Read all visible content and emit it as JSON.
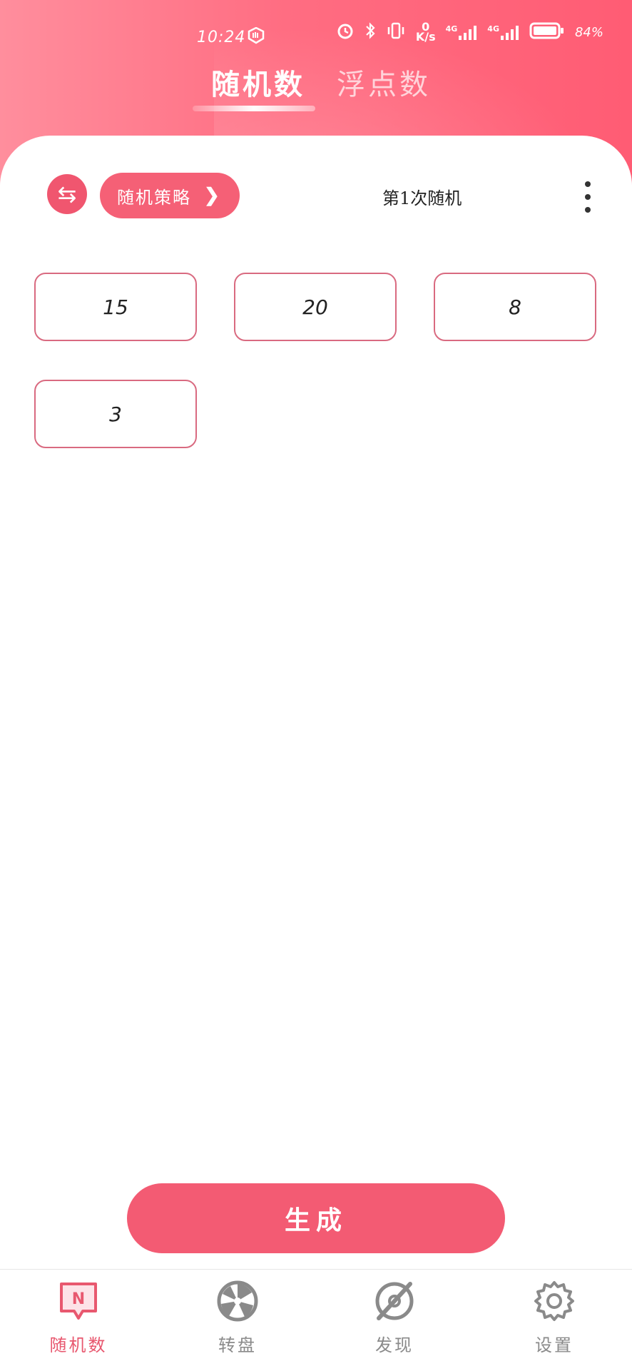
{
  "status_bar": {
    "time": "10:24",
    "net_speed_value": "0",
    "net_speed_unit": "K/s",
    "signal1": "4G",
    "signal2": "4G",
    "battery": "84%"
  },
  "tabs": [
    {
      "label": "随机数",
      "active": true
    },
    {
      "label": "浮点数",
      "active": false
    }
  ],
  "toolbar": {
    "swap_icon": "⇆",
    "strategy_label": "随机策略",
    "chevron": "❯",
    "count_label": "第1次随机"
  },
  "numbers": [
    "15",
    "20",
    "8",
    "3"
  ],
  "generate_label": "生成",
  "bottom_nav": [
    {
      "label": "随机数",
      "icon": "number-badge-icon",
      "icon_text": "N",
      "active": true
    },
    {
      "label": "转盘",
      "icon": "wheel-icon",
      "active": false
    },
    {
      "label": "发现",
      "icon": "compass-icon",
      "active": false
    },
    {
      "label": "设置",
      "icon": "gear-icon",
      "active": false
    }
  ],
  "colors": {
    "accent": "#f35b73",
    "header_start": "#ff8e9d",
    "header_end": "#ff5c74",
    "box_border": "#d96a80",
    "inactive_nav": "#8a8a8a"
  }
}
